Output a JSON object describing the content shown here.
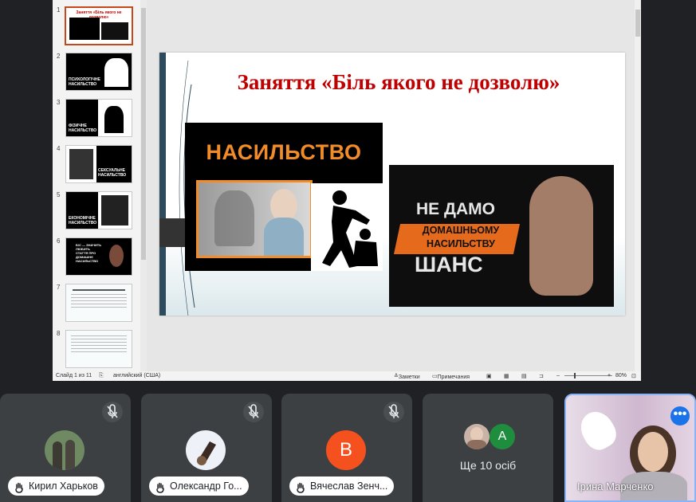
{
  "presentation": {
    "thumbnails": [
      {
        "num": "1",
        "selected": true,
        "caption": "Заняття «Біль якого не дозволю»"
      },
      {
        "num": "2",
        "caption": "ПСИХОЛОГІЧНЕ НАСИЛЬСТВО"
      },
      {
        "num": "3",
        "caption": "ФІЗИЧНЕ НАСИЛЬСТВО"
      },
      {
        "num": "4",
        "caption": "СЕКСУАЛЬНЕ НАСИЛЬСТВО"
      },
      {
        "num": "5",
        "caption": "ЕКОНОМІЧНЕ НАСИЛЬСТВО"
      },
      {
        "num": "6",
        "caption": "Б/С — ЗНАЧИТЬ ЛЮБИТЬ СТАТТЯ ПРО ДОМАШНЄ НАСИЛЬСТВО"
      },
      {
        "num": "7",
        "caption": ""
      },
      {
        "num": "8",
        "caption": ""
      }
    ],
    "slide": {
      "title": "Заняття «Біль якого не дозволю»",
      "image1_heading": "НАСИЛЬСТВО",
      "image2_line1": "НЕ ДАМО",
      "image2_line2": "ДОМАШНЬОМУ",
      "image2_line3": "НАСИЛЬСТВУ",
      "image2_line4": "ШАНС"
    },
    "status": {
      "slide_count": "Слайд 1 из 11",
      "language": "английский (США)",
      "notes": "Заметки",
      "comments": "Примечания",
      "zoom": "80%"
    }
  },
  "participants": [
    {
      "name": "Кирил Харьков",
      "muted": true
    },
    {
      "name": "Олександр Го...",
      "muted": true
    },
    {
      "name": "Вячеслав Зенч...",
      "muted": true,
      "initial": "В",
      "avatar_color": "#f4511e"
    },
    {
      "label": "Ще 10 осіб",
      "initial": "А",
      "avatar_color": "#1e8e3e"
    },
    {
      "name": "Ірина Марченко",
      "self": true
    }
  ]
}
